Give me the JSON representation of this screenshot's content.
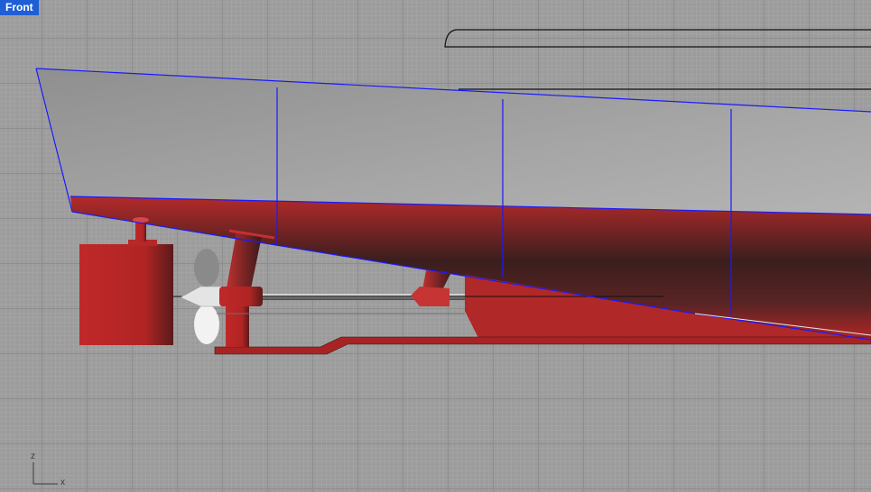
{
  "viewport": {
    "title": "Front"
  },
  "axes": {
    "vertical_label": "z",
    "horizontal_label": "x"
  },
  "colors": {
    "hull_red": "#b32626",
    "hull_dark": "#3a1f1f",
    "hull_gray": "#a9a9a9",
    "wire_blue": "#1a1aff",
    "tab_blue": "#1f5fd6",
    "background": "#9c9c9c"
  },
  "icons": [
    "axis-triad-icon"
  ]
}
